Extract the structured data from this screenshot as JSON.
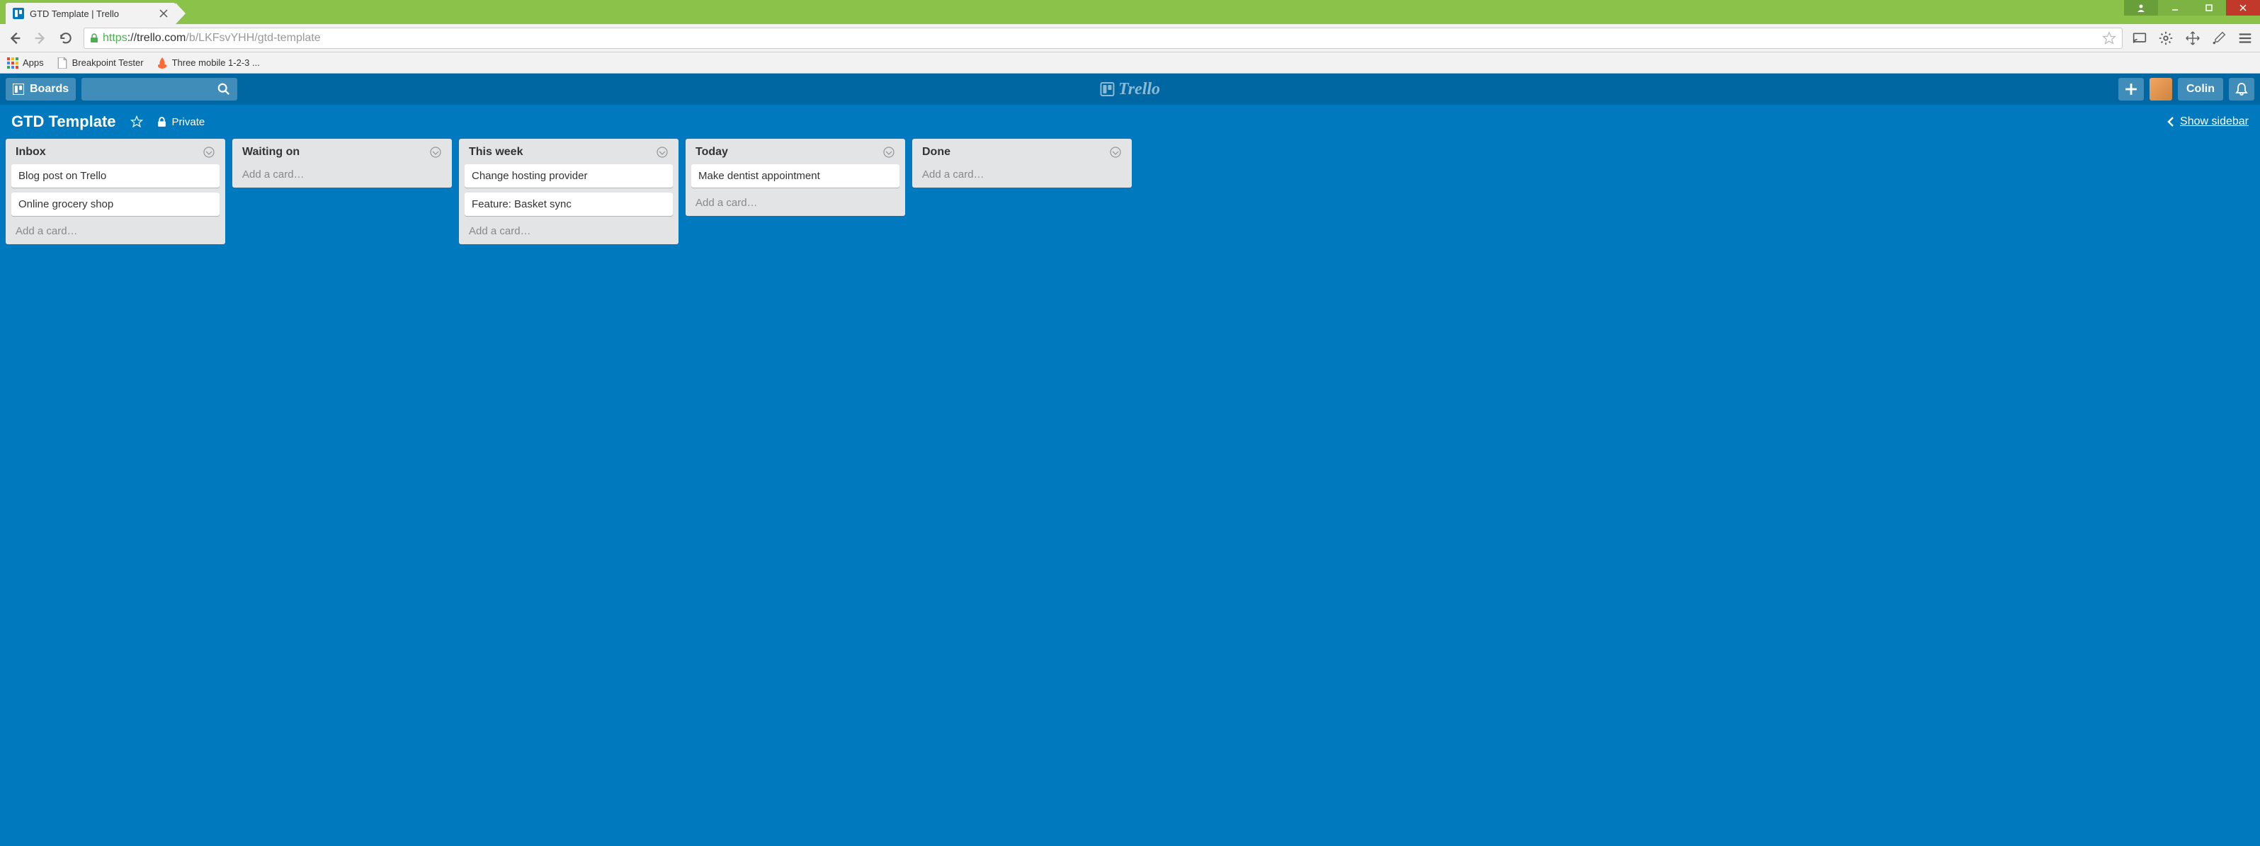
{
  "browser": {
    "tab_title": "GTD Template | Trello",
    "url_proto": "https",
    "url_host": "://trello.com",
    "url_path": "/b/LKFsvYHH/gtd-template",
    "bookmarks": [
      {
        "label": "Apps",
        "icon": "apps"
      },
      {
        "label": "Breakpoint Tester",
        "icon": "page"
      },
      {
        "label": "Three mobile 1-2-3 ...",
        "icon": "fire"
      }
    ]
  },
  "trello": {
    "header": {
      "boards_label": "Boards",
      "logo_text": "Trello",
      "username": "Colin"
    },
    "board": {
      "title": "GTD Template",
      "visibility": "Private",
      "show_sidebar": "Show sidebar"
    },
    "add_card_label": "Add a card…",
    "lists": [
      {
        "title": "Inbox",
        "cards": [
          "Blog post on Trello",
          "Online grocery shop"
        ]
      },
      {
        "title": "Waiting on",
        "cards": []
      },
      {
        "title": "This week",
        "cards": [
          "Change hosting provider",
          "Feature: Basket sync"
        ]
      },
      {
        "title": "Today",
        "cards": [
          "Make dentist appointment"
        ]
      },
      {
        "title": "Done",
        "cards": []
      }
    ]
  }
}
